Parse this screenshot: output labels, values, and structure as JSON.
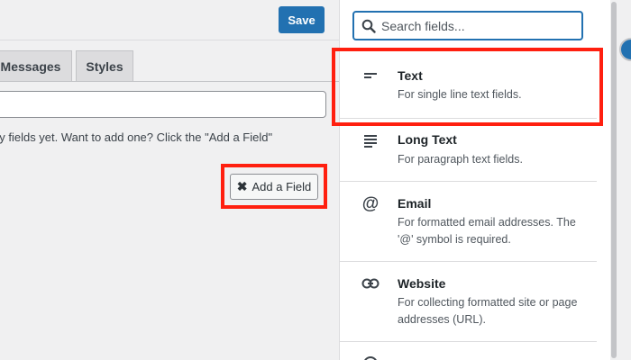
{
  "toolbar": {
    "save_label": "Save"
  },
  "tabs": [
    {
      "label": "Messages"
    },
    {
      "label": "Styles"
    }
  ],
  "form": {
    "empty_message": "ny fields yet. Want to add one? Click the \"Add a Field\"",
    "add_field_label": "Add a Field",
    "add_field_icon": "x-icon"
  },
  "panel": {
    "search_placeholder": "Search fields...",
    "fields": [
      {
        "title": "Text",
        "description": "For single line text fields.",
        "icon": "short-lines-icon"
      },
      {
        "title": "Long Text",
        "description": "For paragraph text fields.",
        "icon": "paragraph-lines-icon"
      },
      {
        "title": "Email",
        "description": "For formatted email addresses. The '@' symbol is required.",
        "icon": "at-sign-icon"
      },
      {
        "title": "Website",
        "description": "For collecting formatted site or page addresses (URL).",
        "icon": "link-icon"
      }
    ]
  },
  "colors": {
    "accent": "#2271b1",
    "highlight": "#ff1f0f",
    "background": "#f0f0f1"
  }
}
